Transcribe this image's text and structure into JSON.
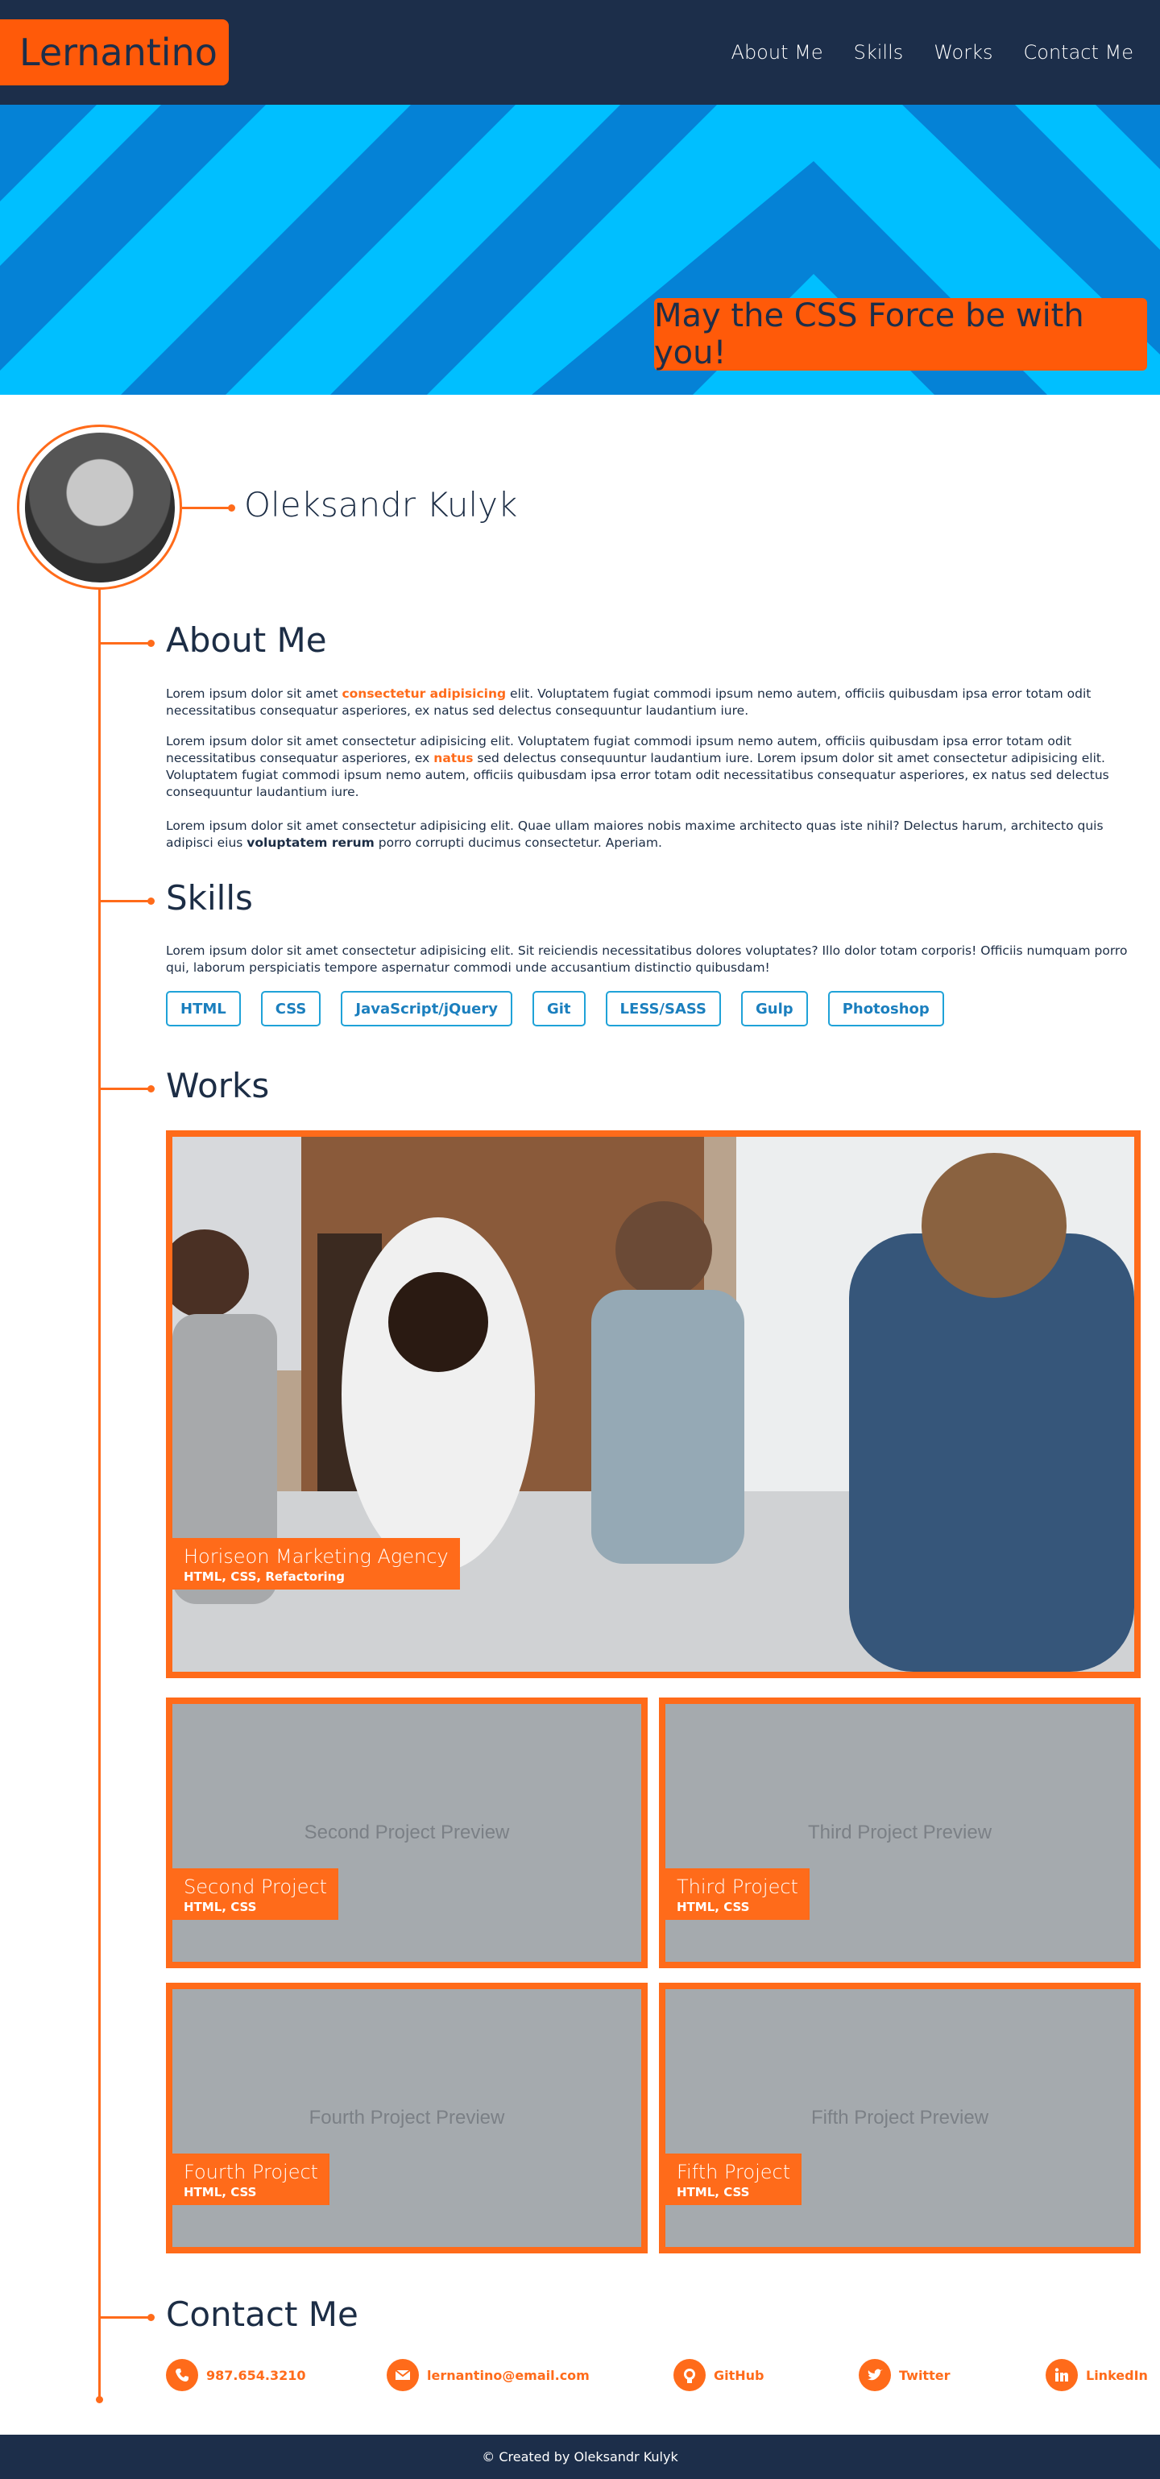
{
  "header": {
    "logo": "Lernantino",
    "nav": [
      "About Me",
      "Skills",
      "Works",
      "Contact Me"
    ]
  },
  "hero": {
    "tagline": "May the CSS Force be with you!"
  },
  "profile": {
    "name": "Oleksandr Kulyk"
  },
  "about": {
    "title": "About Me",
    "p1_a": "Lorem ipsum dolor sit amet ",
    "p1_hl": "consectetur adipisicing",
    "p1_b": " elit. Voluptatem fugiat commodi ipsum nemo autem, officiis quibusdam ipsa error totam odit necessitatibus consequatur asperiores, ex natus sed delectus consequuntur laudantium iure.",
    "p2_a": "Lorem ipsum dolor sit amet consectetur adipisicing elit. Voluptatem fugiat commodi ipsum nemo autem, officiis quibusdam ipsa error totam odit necessitatibus consequatur asperiores, ex ",
    "p2_hl": "natus",
    "p2_b": " sed delectus consequuntur laudantium iure. Lorem ipsum dolor sit amet consectetur adipisicing elit. Voluptatem fugiat commodi ipsum nemo autem, officiis quibusdam ipsa error totam odit necessitatibus consequatur asperiores, ex natus sed delectus consequuntur laudantium iure.",
    "p3_a": "Lorem ipsum dolor sit amet consectetur adipisicing elit. Quae ullam maiores nobis maxime architecto quas iste nihil? Delectus harum, architecto quis adipisci eius ",
    "p3_bold": "voluptatem rerum",
    "p3_b": " porro corrupti ducimus consectetur. Aperiam."
  },
  "skills": {
    "title": "Skills",
    "text": "Lorem ipsum dolor sit amet consectetur adipisicing elit. Sit reiciendis necessitatibus dolores voluptates? Illo dolor totam corporis! Officiis numquam porro qui, laborum perspiciatis tempore aspernatur commodi unde accusantium distinctio quibusdam!",
    "items": [
      "HTML",
      "CSS",
      "JavaScript/jQuery",
      "Git",
      "LESS/SASS",
      "Gulp",
      "Photoshop"
    ]
  },
  "works": {
    "title": "Works",
    "items": [
      {
        "title": "Horiseon Marketing Agency",
        "stack": "HTML, CSS, Refactoring",
        "preview": ""
      },
      {
        "title": "Second Project",
        "stack": "HTML, CSS",
        "preview": "Second Project Preview"
      },
      {
        "title": "Third Project",
        "stack": "HTML, CSS",
        "preview": "Third Project Preview"
      },
      {
        "title": "Fourth Project",
        "stack": "HTML, CSS",
        "preview": "Fourth Project Preview"
      },
      {
        "title": "Fifth Project",
        "stack": "HTML, CSS",
        "preview": "Fifth Project Preview"
      }
    ]
  },
  "contact": {
    "title": "Contact Me",
    "items": [
      {
        "label": "987.654.3210",
        "icon": "phone-icon"
      },
      {
        "label": "lernantino@email.com",
        "icon": "email-icon"
      },
      {
        "label": "GitHub",
        "icon": "github-icon"
      },
      {
        "label": "Twitter",
        "icon": "twitter-icon"
      },
      {
        "label": "LinkedIn",
        "icon": "linkedin-icon"
      }
    ]
  },
  "footer": {
    "text": "© Created by Oleksandr Kulyk"
  },
  "colors": {
    "navy": "#1c2e4a",
    "orange": "#ff6b1a",
    "hero_light": "#00bfff",
    "hero_dark": "#0582d6",
    "skill_blue": "#1fa2d8"
  }
}
